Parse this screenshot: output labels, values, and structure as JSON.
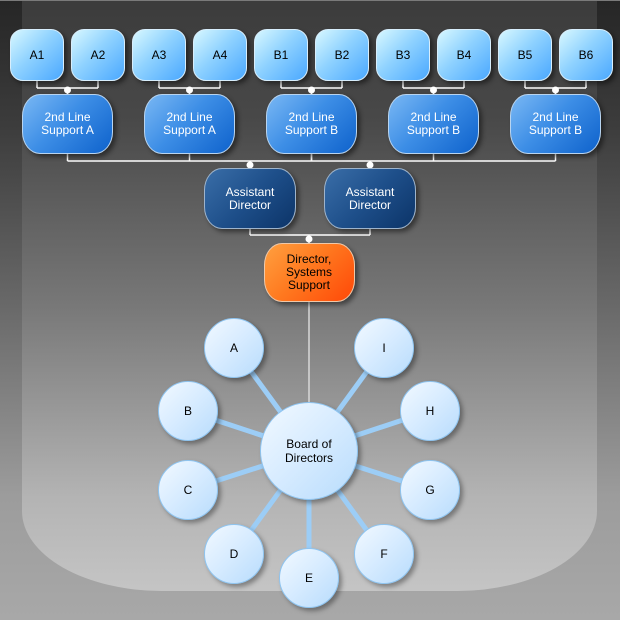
{
  "leaves": [
    {
      "id": "A1",
      "label": "A1"
    },
    {
      "id": "A2",
      "label": "A2"
    },
    {
      "id": "A3",
      "label": "A3"
    },
    {
      "id": "A4",
      "label": "A4"
    },
    {
      "id": "B1",
      "label": "B1"
    },
    {
      "id": "B2",
      "label": "B2"
    },
    {
      "id": "B3",
      "label": "B3"
    },
    {
      "id": "B4",
      "label": "B4"
    },
    {
      "id": "B5",
      "label": "B5"
    },
    {
      "id": "B6",
      "label": "B6"
    }
  ],
  "support": [
    {
      "label": "2nd Line\nSupport A",
      "children": [
        "A1",
        "A2"
      ]
    },
    {
      "label": "2nd Line\nSupport A",
      "children": [
        "A3",
        "A4"
      ]
    },
    {
      "label": "2nd Line\nSupport B",
      "children": [
        "B1",
        "B2"
      ]
    },
    {
      "label": "2nd Line\nSupport B",
      "children": [
        "B3",
        "B4"
      ]
    },
    {
      "label": "2nd Line\nSupport B",
      "children": [
        "B5",
        "B6"
      ]
    }
  ],
  "assistants": [
    {
      "label": "Assistant\nDirector",
      "children": [
        0,
        1,
        2
      ]
    },
    {
      "label": "Assistant\nDirector",
      "children": [
        2,
        3,
        4
      ]
    }
  ],
  "director": {
    "label": "Director,\nSystems\nSupport"
  },
  "board": {
    "label": "Board of\nDirectors",
    "members": [
      "A",
      "B",
      "C",
      "D",
      "E",
      "F",
      "G",
      "H",
      "I"
    ]
  },
  "colors": {
    "leaf": "#8fd2ff",
    "support": "#3d8ee6",
    "assistant": "#1e4f8a",
    "director": "#ff7a20",
    "board": "#d6ebff",
    "connector": "#ffffff",
    "spoke": "#9ccdf6"
  }
}
